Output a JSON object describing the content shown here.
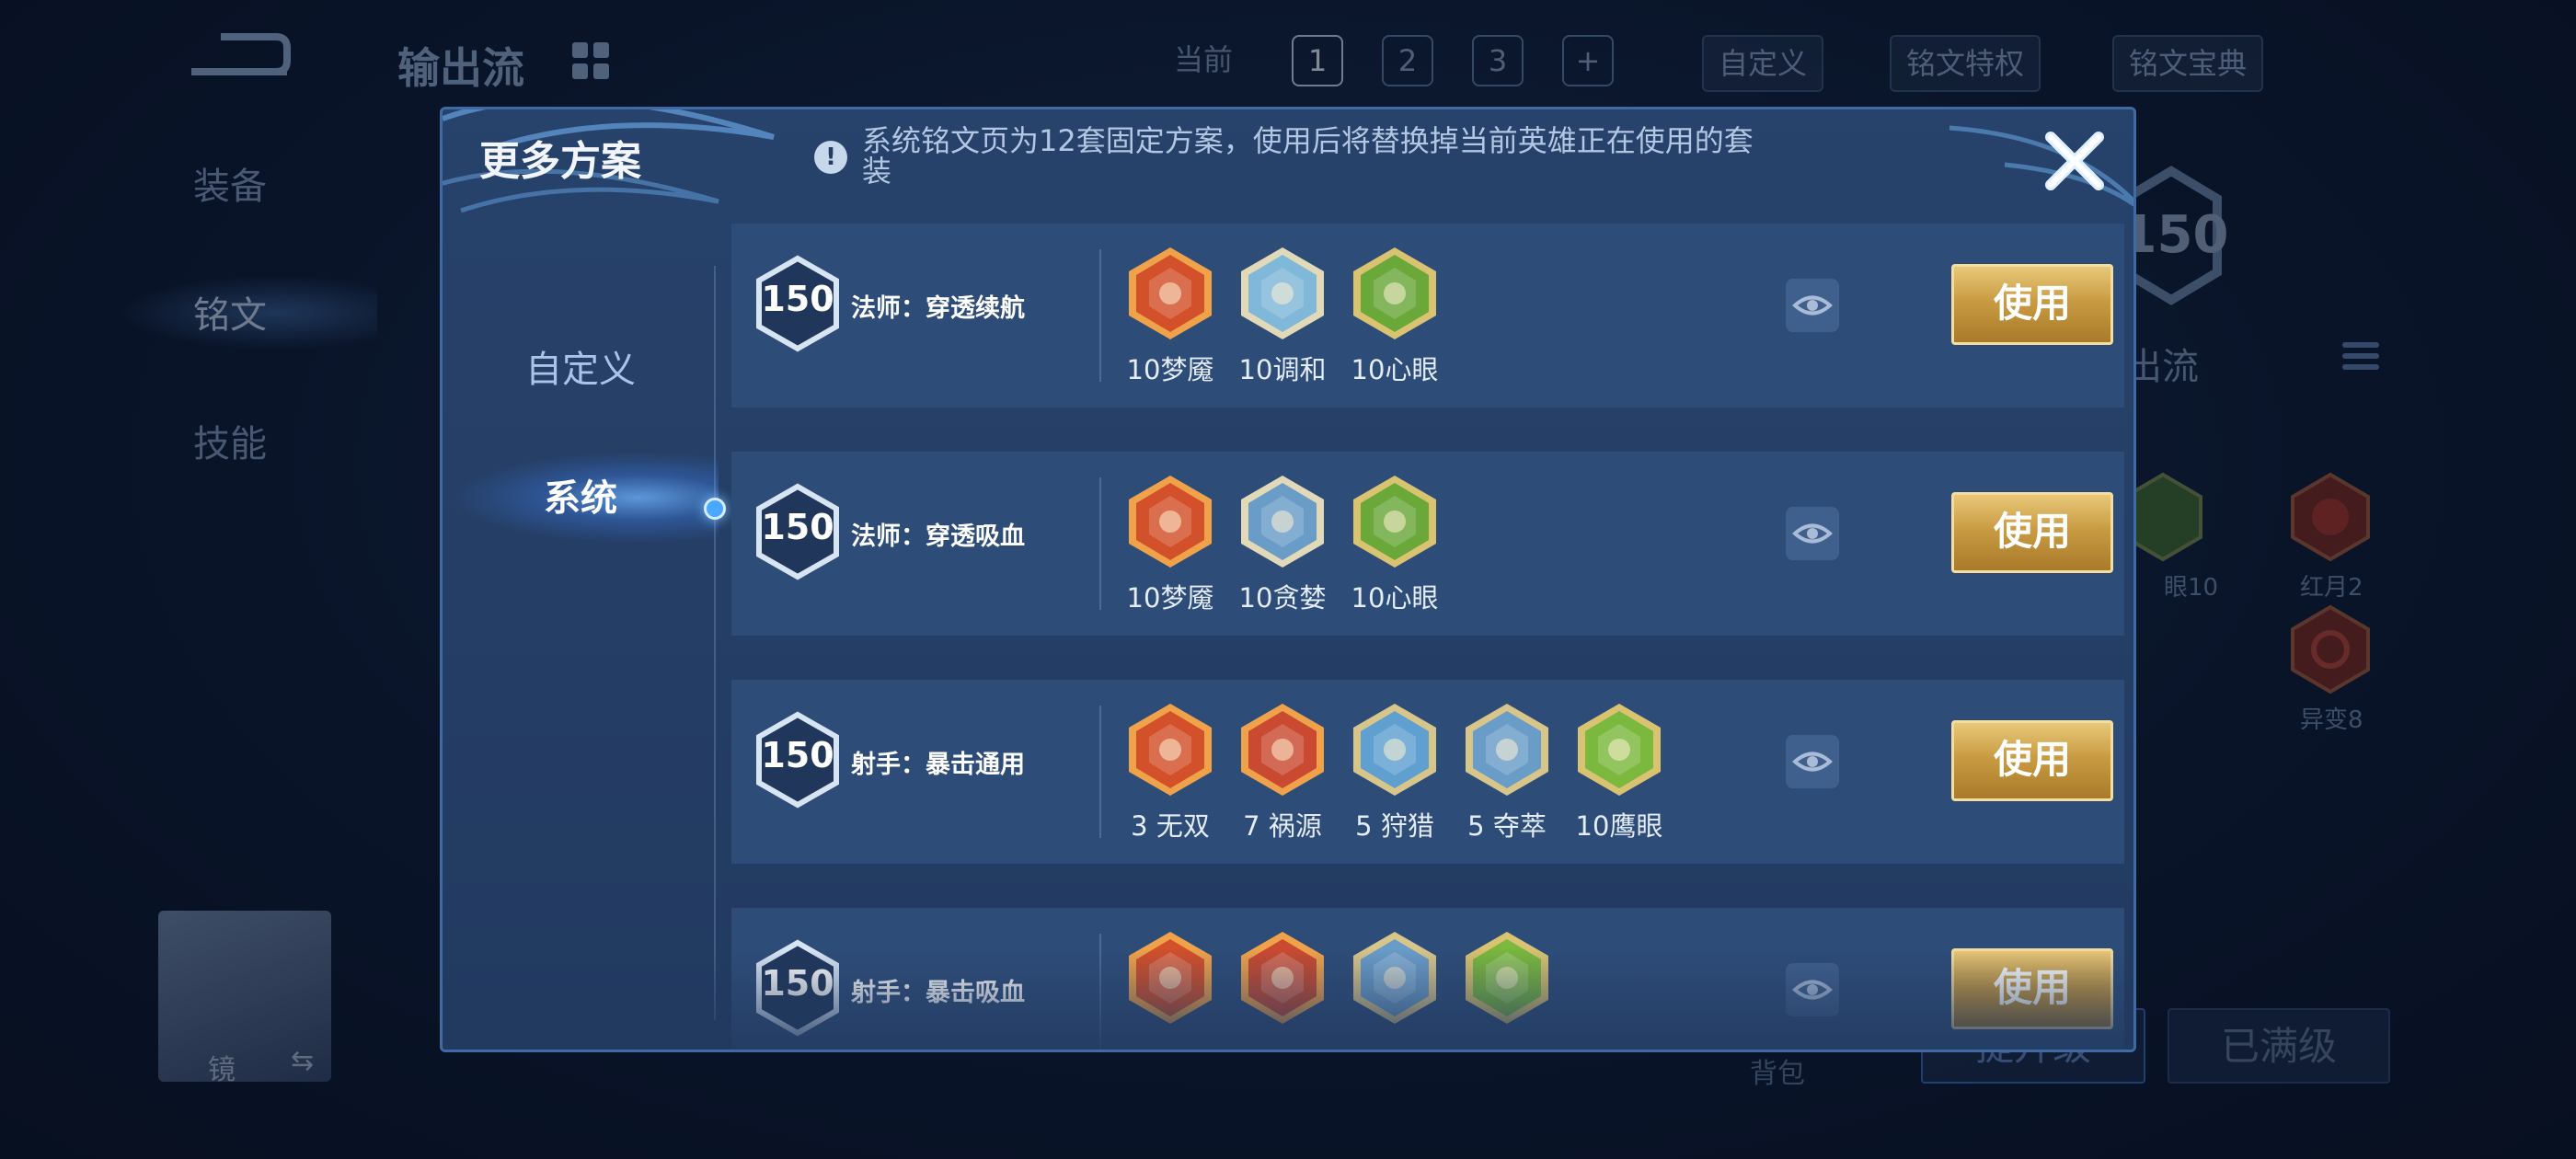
{
  "background": {
    "page_title": "输出流",
    "top_tabs": {
      "current_label": "当前",
      "pages": [
        "1",
        "2",
        "3"
      ],
      "add_label": "+",
      "custom_label": "自定义"
    },
    "top_buttons": {
      "privilege": "铭文特权",
      "codex": "铭文宝典"
    },
    "side_nav": {
      "equipment": "装备",
      "inscription": "铭文",
      "skill": "技能"
    },
    "hero": {
      "name": "镜",
      "swap": "⇆"
    },
    "level_hex": "150",
    "flow_label": "出流",
    "side_gems": [
      {
        "label": "眼10",
        "color": "green"
      },
      {
        "label": "红月2",
        "color": "red"
      },
      {
        "label": "异变8",
        "color": "red"
      }
    ],
    "bottom": {
      "backpack": "背包",
      "upgrade": "提升级",
      "maxed": "已满级"
    }
  },
  "modal": {
    "title": "更多方案",
    "notice": "系统铭文页为12套固定方案，使用后将替换掉当前英雄正在使用的套装",
    "close_icon": "close-icon",
    "tabs": {
      "custom": "自定义",
      "system": "系统"
    },
    "use_label": "使用",
    "rows": [
      {
        "level": "150",
        "name": "法师：穿透续航",
        "gems": [
          {
            "label": "10梦魇",
            "color": "#d2502a",
            "rim": "#f0a24a"
          },
          {
            "label": "10调和",
            "color": "#7fb8d8",
            "rim": "#e2d9b8"
          },
          {
            "label": "10心眼",
            "color": "#6aa83a",
            "rim": "#d9c270"
          }
        ]
      },
      {
        "level": "150",
        "name": "法师：穿透吸血",
        "gems": [
          {
            "label": "10梦魇",
            "color": "#d2502a",
            "rim": "#f0a24a"
          },
          {
            "label": "10贪婪",
            "color": "#6a9cc8",
            "rim": "#e2d9b8"
          },
          {
            "label": "10心眼",
            "color": "#6aa83a",
            "rim": "#d9c270"
          }
        ]
      },
      {
        "level": "150",
        "name": "射手：暴击通用",
        "gems": [
          {
            "label": "3 无双",
            "color": "#d2502a",
            "rim": "#f0a24a"
          },
          {
            "label": "7 祸源",
            "color": "#c94a30",
            "rim": "#f0a24a"
          },
          {
            "label": "5 狩猎",
            "color": "#5fa0d0",
            "rim": "#d8c58a"
          },
          {
            "label": "5 夺萃",
            "color": "#6a9cc8",
            "rim": "#d8c58a"
          },
          {
            "label": "10鹰眼",
            "color": "#7ab83e",
            "rim": "#d9c270"
          }
        ]
      },
      {
        "level": "150",
        "name": "射手：暴击吸血",
        "gems": [
          {
            "label": "",
            "color": "#d2502a",
            "rim": "#f0a24a"
          },
          {
            "label": "",
            "color": "#c94a30",
            "rim": "#f0a24a"
          },
          {
            "label": "",
            "color": "#6a9cc8",
            "rim": "#d8c58a"
          },
          {
            "label": "",
            "color": "#7ab83e",
            "rim": "#d9c270"
          }
        ]
      }
    ]
  }
}
